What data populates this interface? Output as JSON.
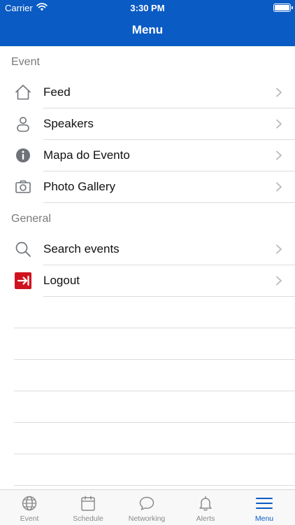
{
  "status_bar": {
    "carrier": "Carrier",
    "time": "3:30 PM"
  },
  "header": {
    "title": "Menu"
  },
  "sections": {
    "event": {
      "label": "Event",
      "items": [
        {
          "label": "Feed",
          "icon": "home-icon"
        },
        {
          "label": "Speakers",
          "icon": "person-icon"
        },
        {
          "label": "Mapa do Evento",
          "icon": "info-icon"
        },
        {
          "label": "Photo Gallery",
          "icon": "camera-icon"
        }
      ]
    },
    "general": {
      "label": "General",
      "items": [
        {
          "label": "Search events",
          "icon": "search-icon"
        },
        {
          "label": "Logout",
          "icon": "logout-icon"
        }
      ]
    }
  },
  "tabbar": {
    "tabs": [
      {
        "label": "Event",
        "icon": "globe-icon"
      },
      {
        "label": "Schedule",
        "icon": "calendar-icon"
      },
      {
        "label": "Networking",
        "icon": "chat-bubble-icon"
      },
      {
        "label": "Alerts",
        "icon": "bell-icon"
      },
      {
        "label": "Menu",
        "icon": "hamburger-menu-icon"
      }
    ],
    "active_tab": "Menu"
  },
  "colors": {
    "brand": "#0a5bc4",
    "logout_icon": "#d0121f"
  }
}
